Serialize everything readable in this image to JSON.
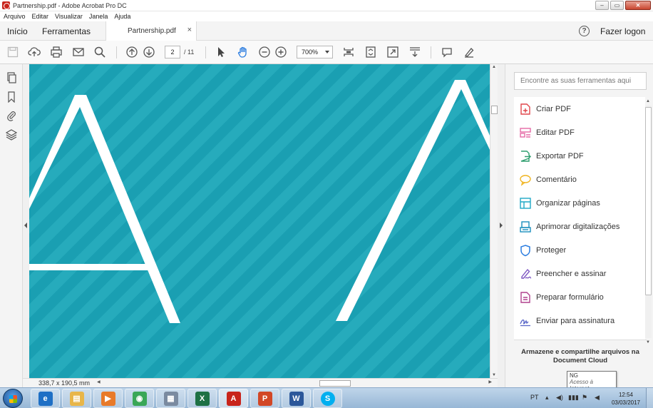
{
  "window": {
    "title": "Partnership.pdf - Adobe Acrobat Pro DC",
    "minimize": "–",
    "maximize": "▭",
    "close": "✕"
  },
  "menu": [
    "Arquivo",
    "Editar",
    "Visualizar",
    "Janela",
    "Ajuda"
  ],
  "tabs": {
    "home": "Início",
    "tools": "Ferramentas",
    "document": "Partnership.pdf",
    "close": "×"
  },
  "header": {
    "help": "?",
    "login": "Fazer logon"
  },
  "toolbar": {
    "page_current": "2",
    "page_total": "/ 11",
    "zoom": "700%"
  },
  "status": {
    "dimensions": "338,7 x 190,5 mm"
  },
  "right_panel": {
    "search_placeholder": "Encontre as suas ferramentas aqui",
    "tools": [
      {
        "label": "Criar PDF",
        "icon": "create-pdf-icon",
        "color": "#e0464b"
      },
      {
        "label": "Editar PDF",
        "icon": "edit-pdf-icon",
        "color": "#e56aa6"
      },
      {
        "label": "Exportar PDF",
        "icon": "export-pdf-icon",
        "color": "#2e9e6e"
      },
      {
        "label": "Comentário",
        "icon": "comment-icon",
        "color": "#f0b522"
      },
      {
        "label": "Organizar páginas",
        "icon": "organize-pages-icon",
        "color": "#1fa8c6"
      },
      {
        "label": "Aprimorar digitalizações",
        "icon": "enhance-scans-icon",
        "color": "#1b8fbd"
      },
      {
        "label": "Proteger",
        "icon": "protect-icon",
        "color": "#2b7de0"
      },
      {
        "label": "Preencher e assinar",
        "icon": "fill-sign-icon",
        "color": "#7e57c2"
      },
      {
        "label": "Preparar formulário",
        "icon": "prepare-form-icon",
        "color": "#b0408e"
      },
      {
        "label": "Enviar para assinatura",
        "icon": "send-signature-icon",
        "color": "#5a67c8"
      }
    ],
    "cloud_text": "Armazene e compartilhe arquivos na Document Cloud"
  },
  "tooltip": {
    "line1": "NG",
    "line2": "Acesso à Internet"
  },
  "taskbar": {
    "apps": [
      {
        "name": "ie",
        "glyph": "e",
        "color": "#1e6fc5"
      },
      {
        "name": "explorer",
        "glyph": "▤",
        "color": "#e8b64a"
      },
      {
        "name": "media",
        "glyph": "▶",
        "color": "#e87a2a"
      },
      {
        "name": "chrome",
        "glyph": "◉",
        "color": "#3aa757"
      },
      {
        "name": "calculator",
        "glyph": "▦",
        "color": "#7a8aa0"
      },
      {
        "name": "excel",
        "glyph": "X",
        "color": "#1e7145"
      },
      {
        "name": "acrobat",
        "glyph": "A",
        "color": "#c8241b"
      },
      {
        "name": "powerpoint",
        "glyph": "P",
        "color": "#d24726"
      },
      {
        "name": "word",
        "glyph": "W",
        "color": "#2b579a"
      },
      {
        "name": "skype",
        "glyph": "S",
        "color": "#00aff0"
      }
    ],
    "language": "PT",
    "time": "12:54",
    "date": "03/03/2017"
  },
  "colors": {
    "document_bg": "#1ba3b5",
    "letter": "#ffffff"
  }
}
